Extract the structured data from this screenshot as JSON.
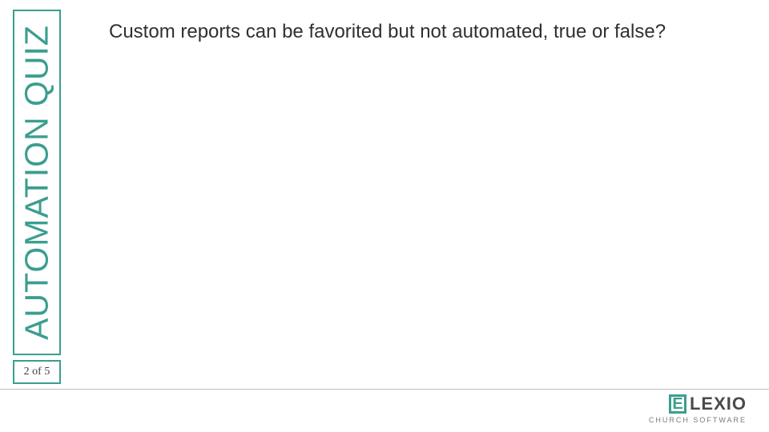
{
  "sidebar": {
    "title": "AUTOMATION QUIZ",
    "pager": "2 of 5"
  },
  "question": {
    "text": "Custom reports can be favorited but not automated, true or false?"
  },
  "logo": {
    "mark": "E",
    "name": "LEXIO",
    "sub": "CHURCH SOFTWARE"
  }
}
